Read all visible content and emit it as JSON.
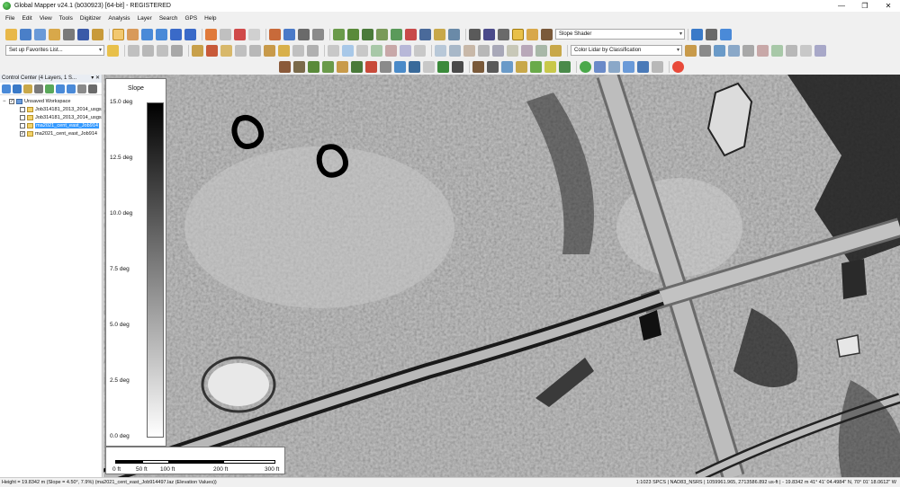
{
  "window": {
    "title": "Global Mapper v24.1 (b030923) [64-bit] - REGISTERED",
    "minimize": "—",
    "maximize": "❐",
    "close": "✕"
  },
  "menu": [
    "File",
    "Edit",
    "View",
    "Tools",
    "Digitizer",
    "Analysis",
    "Layer",
    "Search",
    "GPS",
    "Help"
  ],
  "toolbar": {
    "favorites_placeholder": "Set up Favorites List...",
    "shader": "Slope Shader",
    "lidar_color": "Color Lidar by Classification"
  },
  "control_center": {
    "title": "Control Center (4 Layers, 1 S...",
    "controls": "▾ ✕",
    "root": "Unsaved Workspace",
    "layers": [
      {
        "name": "Job314181_2013_2014_usgs",
        "checked": false,
        "selected": false
      },
      {
        "name": "Job314181_2013_2014_usgs",
        "checked": false,
        "selected": false
      },
      {
        "name": "ma2021_cent_east_Job914",
        "checked": false,
        "selected": true
      },
      {
        "name": "ma2021_cent_east_Job914",
        "checked": true,
        "selected": false
      }
    ]
  },
  "legend": {
    "title": "Slope",
    "ticks": [
      "15.0 deg",
      "12.5 deg",
      "10.0 deg",
      "7.5 deg",
      "5.0 deg",
      "2.5 deg",
      "0.0 deg"
    ]
  },
  "scalebar": {
    "labels": [
      "0 ft",
      "50 ft",
      "100 ft",
      "200 ft",
      "300 ft"
    ]
  },
  "status": {
    "left": "Height = 19.8342 m (Slope = 4.50°, 7.9%) (ma2021_cent_east_Job914497.laz (Elevation Values))",
    "right": "1:1023  SPCS | NAD83_NSRS | 1059961.965, 2713586.892 us-ft | - 19.8342 m  41° 41' 04.4984\" N, 70° 01' 18.0612\" W"
  },
  "colors": {
    "accent": "#3399ff",
    "map_base": "#9a9a9a"
  }
}
